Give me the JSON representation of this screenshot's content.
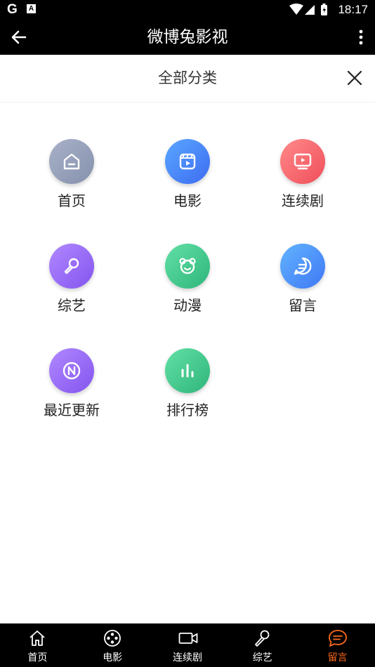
{
  "status_bar": {
    "time": "18:17",
    "left_icons": [
      "google-icon",
      "font-icon"
    ],
    "right_icons": [
      "wifi-icon",
      "signal-icon",
      "battery-icon"
    ]
  },
  "app_bar": {
    "title": "微博兔影视"
  },
  "sheet": {
    "title": "全部分类"
  },
  "categories": [
    {
      "label": "首页",
      "icon": "home-icon",
      "gradient": [
        "#a9b1c8",
        "#8591ad"
      ]
    },
    {
      "label": "电影",
      "icon": "film-icon",
      "gradient": [
        "#5aa7ff",
        "#3d6cf2"
      ]
    },
    {
      "label": "连续剧",
      "icon": "tv-icon",
      "gradient": [
        "#ff8a8a",
        "#f04e5a"
      ]
    },
    {
      "label": "综艺",
      "icon": "microphone-icon",
      "gradient": [
        "#b088ff",
        "#8455ef"
      ]
    },
    {
      "label": "动漫",
      "icon": "bear-icon",
      "gradient": [
        "#62e0a6",
        "#2fb57a"
      ]
    },
    {
      "label": "留言",
      "icon": "message-icon",
      "gradient": [
        "#62b4ff",
        "#3f78f5"
      ]
    },
    {
      "label": "最近更新",
      "icon": "new-icon",
      "gradient": [
        "#b088ff",
        "#8455ef"
      ]
    },
    {
      "label": "排行榜",
      "icon": "chart-icon",
      "gradient": [
        "#62e0a6",
        "#2fb57a"
      ]
    }
  ],
  "bottom_nav": [
    {
      "label": "首页",
      "icon": "home-icon",
      "active": false
    },
    {
      "label": "电影",
      "icon": "film-reel-icon",
      "active": false
    },
    {
      "label": "连续剧",
      "icon": "video-camera-icon",
      "active": false
    },
    {
      "label": "综艺",
      "icon": "microphone-icon",
      "active": false
    },
    {
      "label": "留言",
      "icon": "message-icon",
      "active": true
    }
  ],
  "colors": {
    "bar_background": "#000000",
    "active_tab": "#ff6a1a"
  }
}
